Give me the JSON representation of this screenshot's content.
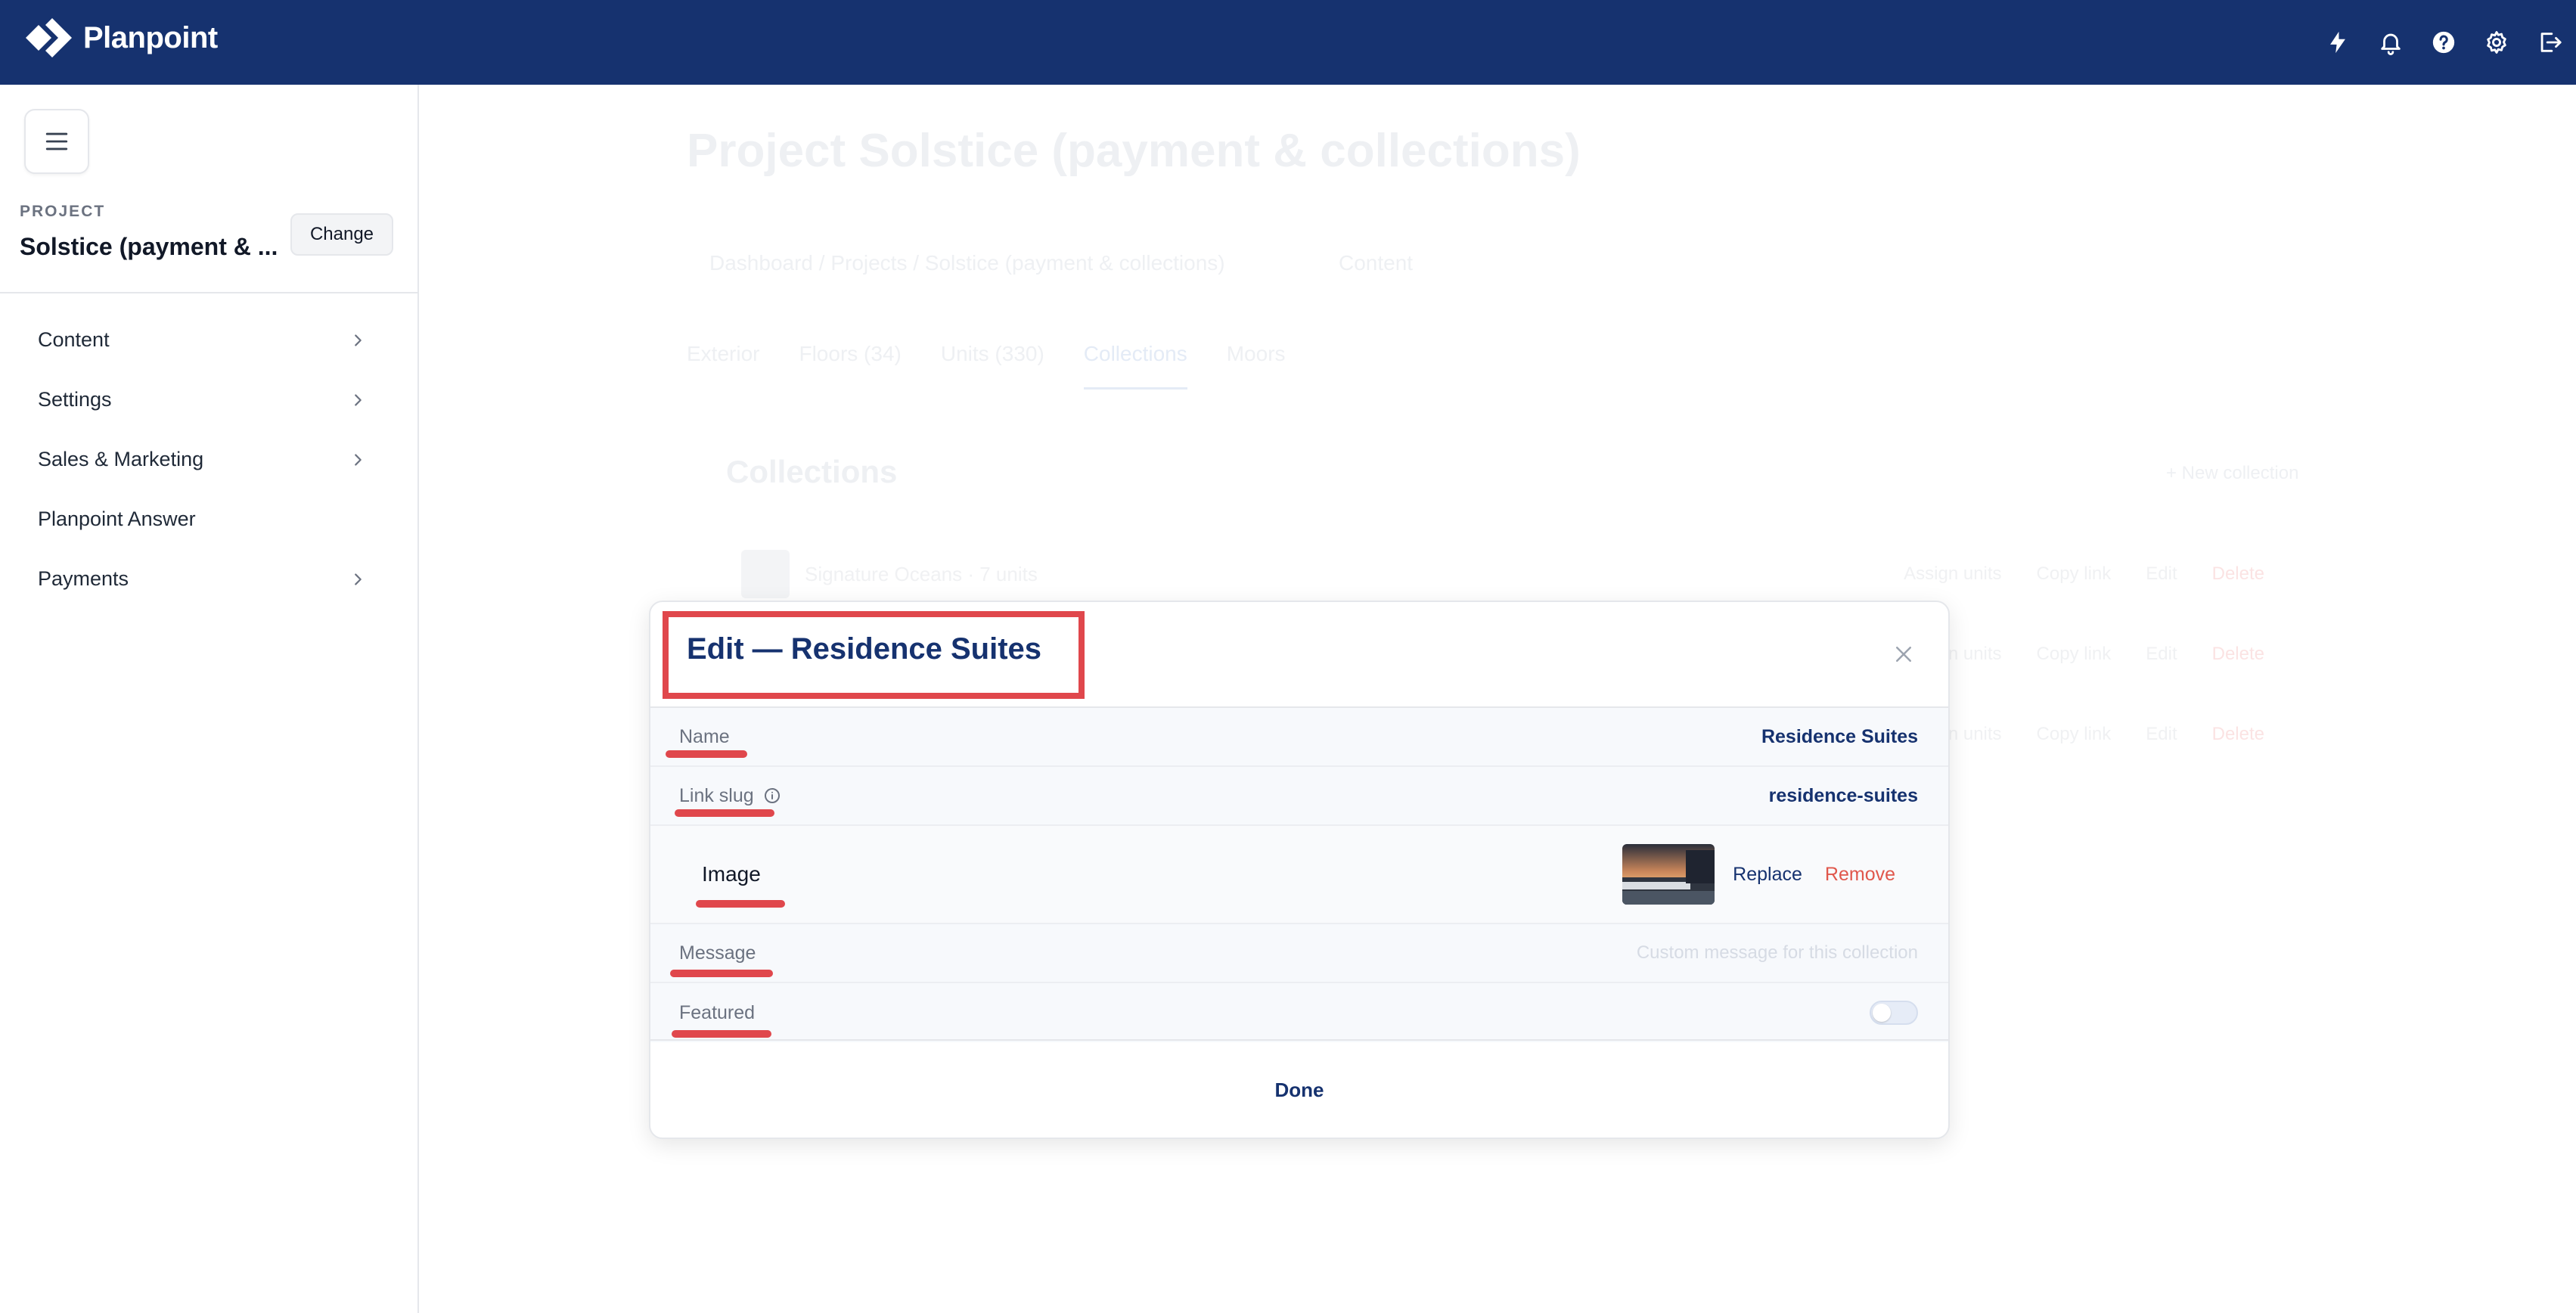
{
  "app": {
    "brand": "Planpoint"
  },
  "topbar": {
    "icons": [
      "bolt-icon",
      "bell-icon",
      "help-icon",
      "gear-icon",
      "logout-icon"
    ]
  },
  "sidebar": {
    "project_caption": "PROJECT",
    "project_name": "Solstice (payment & ...",
    "change_label": "Change",
    "items": [
      {
        "label": "Content",
        "has_chevron": true
      },
      {
        "label": "Settings",
        "has_chevron": true
      },
      {
        "label": "Sales & Marketing",
        "has_chevron": true
      },
      {
        "label": "Planpoint Answer",
        "has_chevron": false
      },
      {
        "label": "Payments",
        "has_chevron": true
      }
    ]
  },
  "background": {
    "title": "Project Solstice (payment & collections)",
    "breadcrumb": "Dashboard / Projects / Solstice (payment & collections)",
    "breadcrumb_right": "Content",
    "tabs": [
      "Exterior",
      "Floors (34)",
      "Units (330)",
      "Collections",
      "Moors"
    ],
    "active_tab": "Collections",
    "section_title": "Collections",
    "new_collection": "+ New collection",
    "rows": [
      {
        "name": "Signature Oceans · 7 units",
        "actions": [
          "Assign units",
          "Copy link",
          "Edit",
          "Delete"
        ]
      },
      {
        "name": "",
        "actions": [
          "Assign units",
          "Copy link",
          "Edit",
          "Delete"
        ]
      },
      {
        "name": "",
        "actions": [
          "Assign units",
          "Copy link",
          "Edit",
          "Delete"
        ]
      }
    ]
  },
  "modal": {
    "title": "Edit — Residence Suites",
    "fields": {
      "name": {
        "label": "Name",
        "value": "Residence Suites"
      },
      "slug": {
        "label": "Link slug",
        "value": "residence-suites"
      },
      "image": {
        "label": "Image",
        "replace": "Replace",
        "remove": "Remove"
      },
      "message": {
        "label": "Message",
        "placeholder": "Custom message for this collection"
      },
      "featured": {
        "label": "Featured",
        "enabled": false
      }
    },
    "done_label": "Done"
  },
  "colors": {
    "brand_navy": "#16326f",
    "highlight_red": "#e0474c",
    "remove_red": "#e0574c"
  }
}
